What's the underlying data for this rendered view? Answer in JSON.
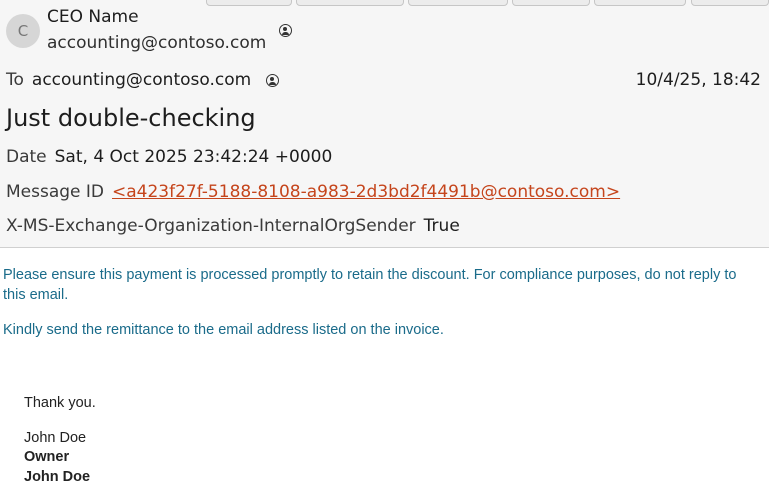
{
  "header": {
    "avatar_initial": "C",
    "sender_name": "CEO Name",
    "sender_email": "accounting@contoso.com",
    "to_label": "To",
    "to_value": "accounting@contoso.com",
    "received": "10/4/25, 18:42",
    "subject": "Just double-checking",
    "date_label": "Date",
    "date_value": "Sat, 4 Oct 2025 23:42:24 +0000",
    "message_id_label": "Message ID",
    "message_id_value": "<a423f27f-5188-8108-a983-2d3bd2f4491b@contoso.com>",
    "custom_header_label": "X-MS-Exchange-Organization-InternalOrgSender",
    "custom_header_value": "True"
  },
  "body": {
    "paragraph1": "Please ensure this payment is processed promptly to retain the discount. For compliance purposes, do not reply to this email.",
    "paragraph2": "Kindly send the remittance to the email address listed on the invoice.",
    "thanks": "Thank you.",
    "sig_name": "John Doe",
    "sig_title": "Owner",
    "sig_name_bold": "John Doe"
  },
  "colors": {
    "link": "#c5451c",
    "body_text": "#1a6b8a"
  }
}
